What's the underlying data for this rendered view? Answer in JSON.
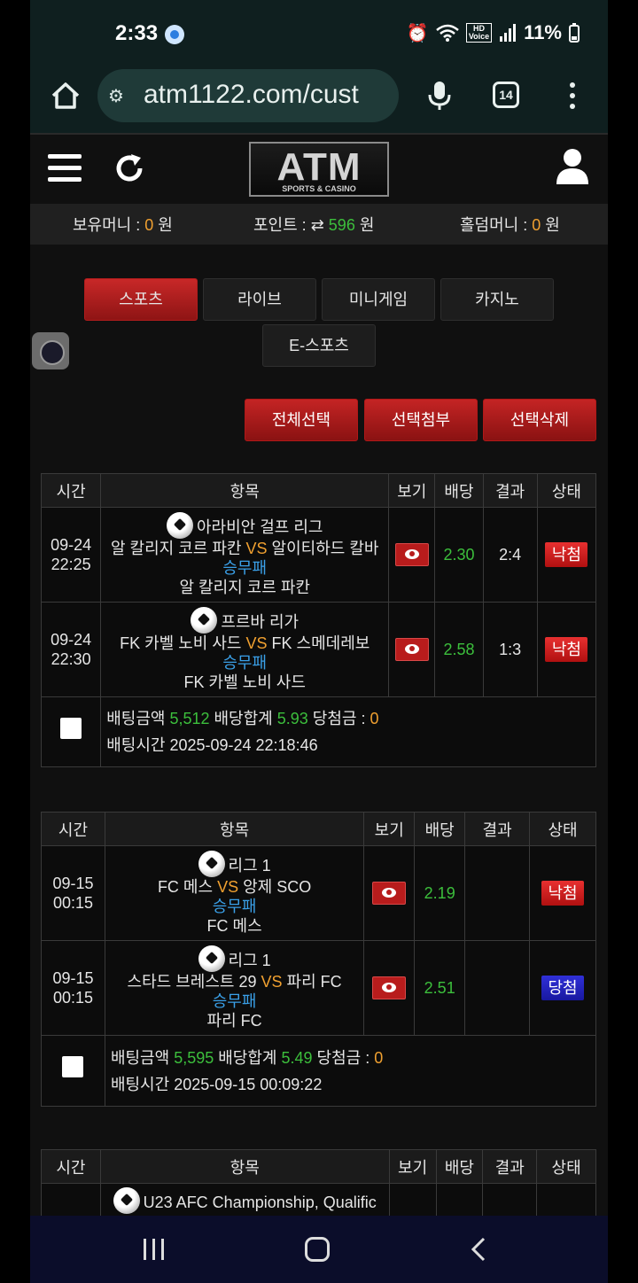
{
  "status_bar": {
    "time": "2:33",
    "battery": "11%",
    "icons": [
      "alarm-icon",
      "wifi-icon",
      "hd-voice-icon",
      "signal-icon",
      "battery-icon"
    ]
  },
  "browser": {
    "url": "atm1122.com/cust",
    "tab_count": "14"
  },
  "header": {
    "logo_main": "ATM",
    "logo_sub": "SPORTS & CASINO"
  },
  "balance": {
    "money_label": "보유머니 : ",
    "money_value": "0",
    "money_unit": " 원",
    "point_label": "포인트 : ",
    "point_icon": "⇄",
    "point_value": "596",
    "point_unit": " 원",
    "hold_label": "홀덤머니 : ",
    "hold_value": "0",
    "hold_unit": " 원"
  },
  "categories": [
    "스포츠",
    "라이브",
    "미니게임",
    "카지노",
    "E-스포츠"
  ],
  "actions": {
    "select_all": "전체선택",
    "attach": "선택첨부",
    "delete": "선택삭제"
  },
  "table_headers": {
    "time": "시간",
    "item": "항목",
    "view": "보기",
    "odds": "배당",
    "result": "결과",
    "status": "상태"
  },
  "summary_labels": {
    "amount": "배팅금액 ",
    "total": " 배당합계 ",
    "win": " 당첨금 : ",
    "time": "배팅시간 "
  },
  "bets": [
    {
      "rows": [
        {
          "date": "09-24",
          "time": "22:25",
          "league": "아라비안 걸프 리그",
          "home": "알 칼리지 코르 파칸",
          "vs": "VS",
          "away": "알이티하드 칼바",
          "market": "승무패",
          "pick": "알 칼리지 코르 파칸",
          "odds": "2.30",
          "result": "2:4",
          "status": "낙첨"
        },
        {
          "date": "09-24",
          "time": "22:30",
          "league": "프르바 리가",
          "home": "FK 카벨 노비 사드",
          "vs": "VS",
          "away": "FK 스메데레보",
          "market": "승무패",
          "pick": "FK 카벨 노비 사드",
          "odds": "2.58",
          "result": "1:3",
          "status": "낙첨"
        }
      ],
      "amount": "5,512",
      "total_odds": "5.93",
      "winnings": "0",
      "bet_time": "2025-09-24 22:18:46"
    },
    {
      "rows": [
        {
          "date": "09-15",
          "time": "00:15",
          "league": "리그 1",
          "home": "FC 메스",
          "vs": "VS",
          "away": "앙제 SCO",
          "market": "승무패",
          "pick": "FC 메스",
          "odds": "2.19",
          "result": "",
          "status": "낙첨"
        },
        {
          "date": "09-15",
          "time": "00:15",
          "league": "리그 1",
          "home": "스타드 브레스트 29",
          "vs": "VS",
          "away": "파리 FC",
          "market": "승무패",
          "pick": "파리 FC",
          "odds": "2.51",
          "result": "",
          "status": "당첨"
        }
      ],
      "amount": "5,595",
      "total_odds": "5.49",
      "winnings": "0",
      "bet_time": "2025-09-15 00:09:22"
    },
    {
      "rows": [
        {
          "league": "U23 AFC Championship, Qualific"
        }
      ]
    }
  ]
}
